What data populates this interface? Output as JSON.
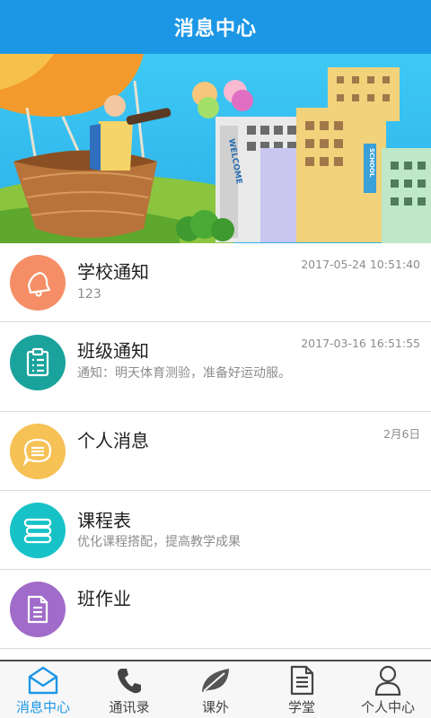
{
  "header": {
    "title": "消息中心"
  },
  "banner": {
    "welcome_text": "WELCOME",
    "school_text": "SCHOOL"
  },
  "list": [
    {
      "title": "学校通知",
      "subtitle": "123",
      "time": "2017-05-24 10:51:40",
      "icon": "bell-icon",
      "color": "#f58e66"
    },
    {
      "title": "班级通知",
      "subtitle": "通知：明天体育测验，准备好运动服。",
      "time": "2017-03-16 16:51:55",
      "icon": "clipboard-icon",
      "color": "#1aa39c"
    },
    {
      "title": "个人消息",
      "subtitle": "",
      "time": "2月6日",
      "icon": "chat-bubble-icon",
      "color": "#f6c155"
    },
    {
      "title": "课程表",
      "subtitle": "优化课程搭配，提高教学成果",
      "time": "",
      "icon": "books-icon",
      "color": "#17c2c7"
    },
    {
      "title": "班作业",
      "subtitle": "",
      "time": "",
      "icon": "document-icon",
      "color": "#a06bc9"
    }
  ],
  "tabs": [
    {
      "label": "消息中心",
      "icon": "envelope-icon",
      "active": true
    },
    {
      "label": "通讯录",
      "icon": "phone-icon",
      "active": false
    },
    {
      "label": "课外",
      "icon": "leaf-icon",
      "active": false
    },
    {
      "label": "学堂",
      "icon": "document-icon",
      "active": false
    },
    {
      "label": "个人中心",
      "icon": "person-icon",
      "active": false
    }
  ],
  "colors": {
    "accent": "#1c97e6",
    "divider": "#d9d9d9",
    "secondary_text": "#8c8c8c"
  }
}
